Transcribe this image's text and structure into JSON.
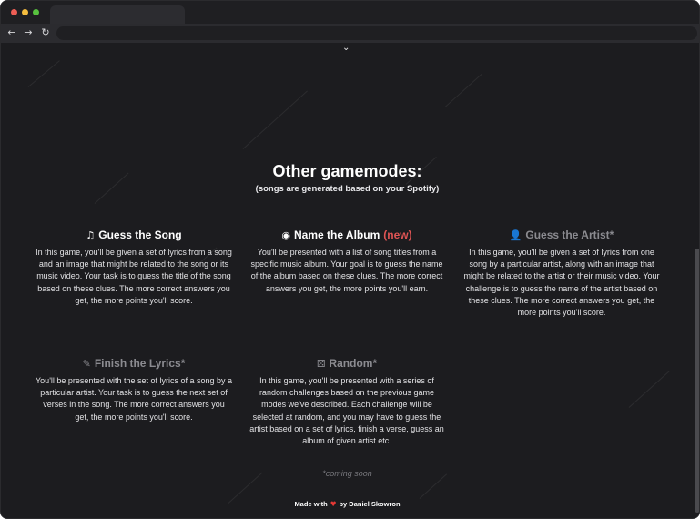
{
  "browser": {
    "back_icon": "arrow-left-icon",
    "forward_icon": "arrow-right-icon",
    "reload_icon": "reload-icon"
  },
  "page": {
    "heading": "Other gamemodes:",
    "subheading": "(songs are generated based on your Spotify)",
    "modes": [
      {
        "icon": "music-note-icon",
        "glyph": "♫",
        "title": "Guess the Song",
        "badge": "",
        "coming_soon": false,
        "description": "In this game, you'll be given a set of lyrics from a song and an image that might be related to the song or its music video. Your task is to guess the title of the song based on these clues. The more correct answers you get, the more points you'll score."
      },
      {
        "icon": "album-icon",
        "glyph": "◉",
        "title": "Name the Album",
        "badge": "(new)",
        "coming_soon": false,
        "description": "You'll be presented with a list of song titles from a specific music album. Your goal is to guess the name of the album based on these clues. The more correct answers you get, the more points you'll earn."
      },
      {
        "icon": "user-icon",
        "glyph": "👤",
        "title": "Guess the Artist*",
        "badge": "",
        "coming_soon": true,
        "description": "In this game, you'll be given a set of lyrics from one song by a particular artist, along with an image that might be related to the artist or their music video. Your challenge is to guess the name of the artist based on these clues. The more correct answers you get, the more points you'll score."
      },
      {
        "icon": "edit-lyrics-icon",
        "glyph": "✎",
        "title": "Finish the Lyrics*",
        "badge": "",
        "coming_soon": true,
        "description": "You'll be presented with the set of lyrics of a song by a particular artist. Your task is to guess the next set of verses in the song. The more correct answers you get, the more points you'll score."
      },
      {
        "icon": "dice-icon",
        "glyph": "⚄",
        "title": "Random*",
        "badge": "",
        "coming_soon": true,
        "description": "In this game, you'll be presented with a series of random challenges based on the previous game modes we've described. Each challenge will be selected at random, and you may have to guess the artist based on a set of lyrics, finish a verse, guess an album of given artist etc."
      }
    ],
    "coming_soon_note": "*coming soon",
    "footer": {
      "made_with": "Made with",
      "by": "by Daniel Skowron"
    }
  },
  "colors": {
    "background": "#1c1c1f",
    "new_badge": "#e05454",
    "heart": "#e53935",
    "disabled_title": "#8b8b90"
  }
}
